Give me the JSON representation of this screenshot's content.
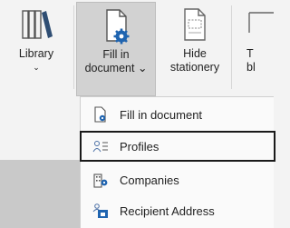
{
  "ribbon": {
    "library": {
      "label": "Library",
      "caret": "⌄"
    },
    "fill_in_document": {
      "label_line1": "Fill in",
      "label_line2": "document ⌄"
    },
    "hide_stationery": {
      "label_line1": "Hide",
      "label_line2": "stationery"
    },
    "partial_button": {
      "label_line1": "T",
      "label_line2": "bl"
    }
  },
  "menu": {
    "items": [
      {
        "label": "Fill in document",
        "icon": "fill-document-icon"
      },
      {
        "label": "Profiles",
        "icon": "profiles-icon"
      },
      {
        "label": "Companies",
        "icon": "companies-icon"
      },
      {
        "label": "Recipient Address",
        "icon": "recipient-address-icon"
      }
    ]
  },
  "colors": {
    "accent_blue": "#2b79c2",
    "selected_border": "#1a1a1a",
    "pressed_button": "#d2d2d2"
  }
}
